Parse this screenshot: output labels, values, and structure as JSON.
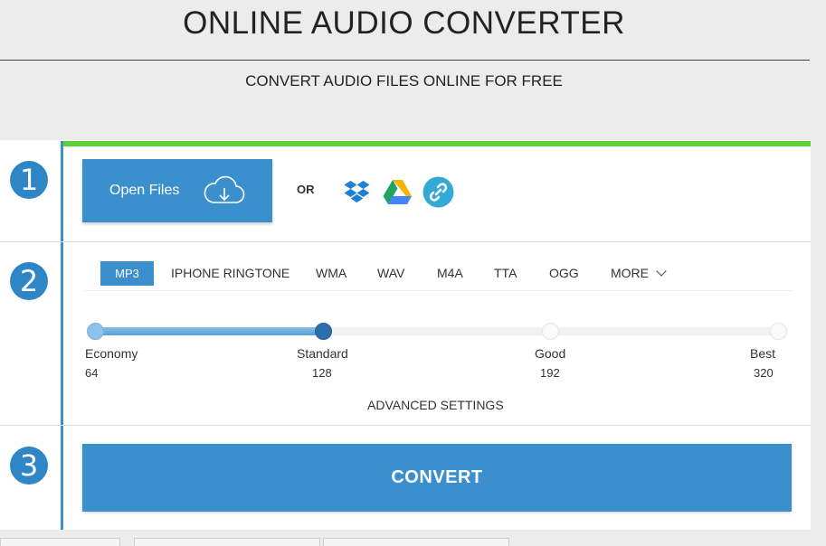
{
  "header": {
    "title": "ONLINE AUDIO CONVERTER",
    "subtitle": "CONVERT AUDIO FILES ONLINE FOR FREE"
  },
  "steps": [
    "1",
    "2",
    "3"
  ],
  "step1": {
    "open_files_label": "Open Files",
    "or_label": "OR",
    "sources": [
      "dropbox-icon",
      "google-drive-icon",
      "link-icon"
    ]
  },
  "step2": {
    "formats": [
      "MP3",
      "IPHONE RINGTONE",
      "WMA",
      "WAV",
      "M4A",
      "TTA",
      "OGG",
      "MORE"
    ],
    "selected_format": "MP3",
    "quality": {
      "levels": [
        {
          "label": "Economy",
          "value": "64"
        },
        {
          "label": "Standard",
          "value": "128"
        },
        {
          "label": "Good",
          "value": "192"
        },
        {
          "label": "Best",
          "value": "320"
        }
      ],
      "selected": "Standard"
    },
    "advanced_label": "ADVANCED SETTINGS"
  },
  "step3": {
    "convert_label": "CONVERT"
  },
  "colors": {
    "accent": "#3a8fcc",
    "progress_green": "#5cd13e",
    "slider_selected": "#2c6fae"
  }
}
